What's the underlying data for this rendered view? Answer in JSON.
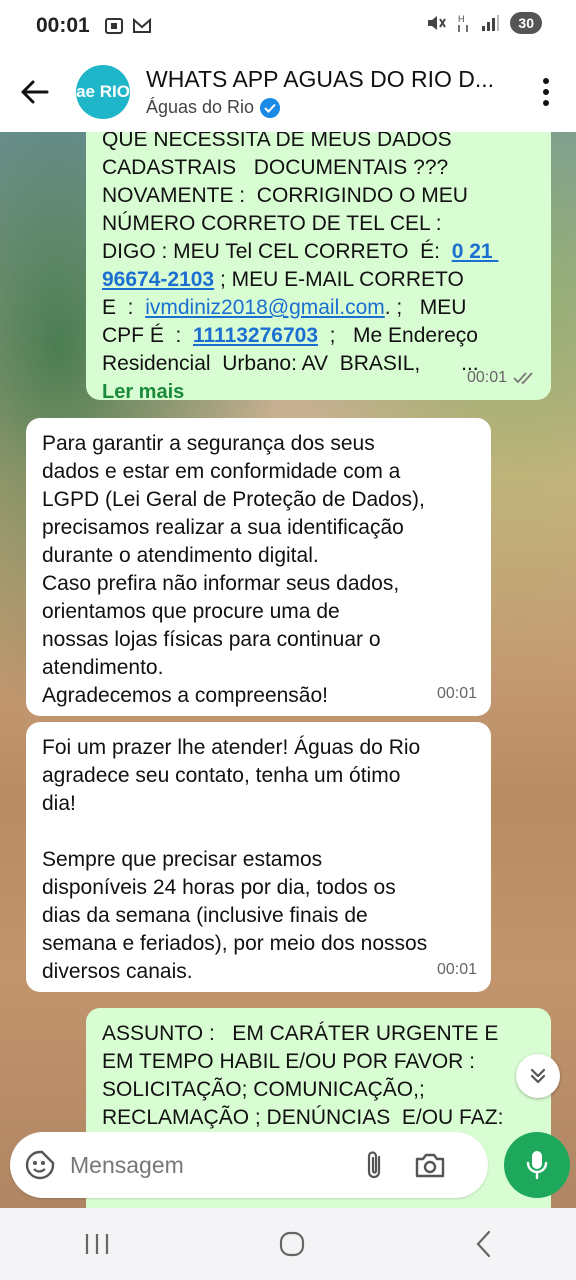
{
  "status": {
    "time": "00:01",
    "battery": "30"
  },
  "header": {
    "title": "WHATS APP AGUAS DO RIO D...",
    "subtitle": "Águas do Rio",
    "avatar_text": "ae RIO"
  },
  "messages": [
    {
      "direction": "out",
      "text_before": "QUE NECESSITA DE MEUS DADOS\nCADASTRAIS   DOCUMENTAIS ???\nNOVAMENTE :  CORRIGINDO O MEU\nNÚMERO CORRETO DE TEL CEL :\nDIGO : MEU Tel CEL CORRETO  É:  ",
      "phone": "0 21 96674-2103",
      "text_mid1": " ; MEU E-MAIL CORRETO\nE  :  ",
      "email": "ivmdiniz2018@gmail.com",
      "text_mid2": ". ;   MEU\nCPF É  :  ",
      "cpf": "11113276703",
      "text_after": "  ;   Me Endereço\nResidencial  Urbano: AV  BRASIL,       ...",
      "read_more": "Ler mais",
      "time": "00:01"
    },
    {
      "direction": "in",
      "text": "Para garantir a segurança dos seus\ndados e estar em conformidade com a\nLGPD (Lei Geral de Proteção de Dados),\nprecisamos realizar a sua identificação\ndurante o atendimento digital.\nCaso prefira não informar seus dados,\norientamos que procure uma de\nnossas lojas físicas para continuar o\natendimento.\nAgradecemos a compreensão!",
      "time": "00:01"
    },
    {
      "direction": "in",
      "text": "Foi um prazer lhe atender! Águas do Rio\nagradece seu contato, tenha um ótimo\ndia!\n\nSempre que precisar estamos\ndisponíveis 24 horas por dia, todos os\ndias da semana (inclusive finais de\nsemana e feriados), por meio dos nossos\ndiversos canais.",
      "time": "00:01"
    },
    {
      "direction": "out",
      "text": "ASSUNTO :   EM CARÁTER URGENTE E\nEM TEMPO HABIL E/OU POR FAVOR :\nSOLICITAÇÃO; COMUNICAÇÃO,;\nRECLAMAÇÃO ; DENÚNCIAS  E/OU FAZ:"
    }
  ],
  "input": {
    "placeholder": "Mensagem"
  },
  "colors": {
    "outgoing_bubble": "#d9fdd3",
    "incoming_bubble": "#ffffff",
    "accent": "#1ea85c",
    "link": "#1a6fd1"
  }
}
